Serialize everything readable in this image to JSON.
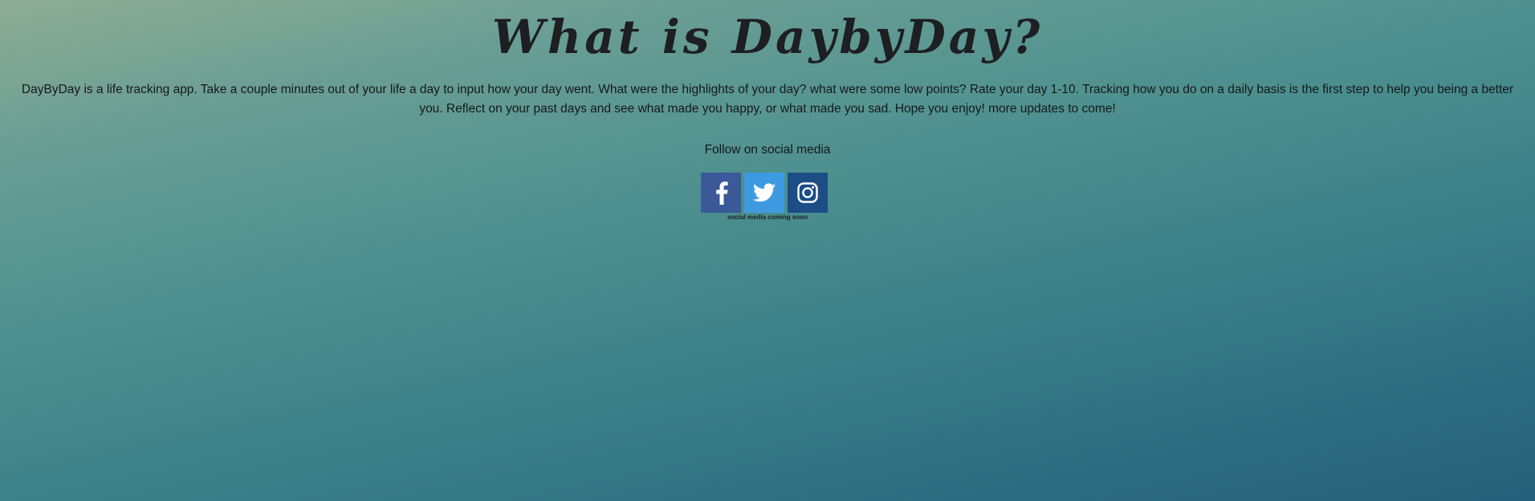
{
  "header": {
    "title": "What is DaybyDay?"
  },
  "main": {
    "description": "DayByDay is a life tracking app. Take a couple minutes out of your life a day to input how your day went. What were the highlights of your day? what were some low points? Rate your day 1-10. Tracking how you do on a daily basis is the first step to help you being a better you. Reflect on your past days and see what made you happy, or what made you sad. Hope you enjoy! more updates to come!",
    "follow_label": "Follow on social media",
    "social_note": "social media coming soon"
  },
  "social": [
    {
      "name": "facebook",
      "icon": "facebook-icon",
      "color": "#3b5998"
    },
    {
      "name": "twitter",
      "icon": "twitter-icon",
      "color": "#3e9ae0"
    },
    {
      "name": "instagram",
      "icon": "instagram-icon",
      "color": "#1c4d84"
    }
  ]
}
